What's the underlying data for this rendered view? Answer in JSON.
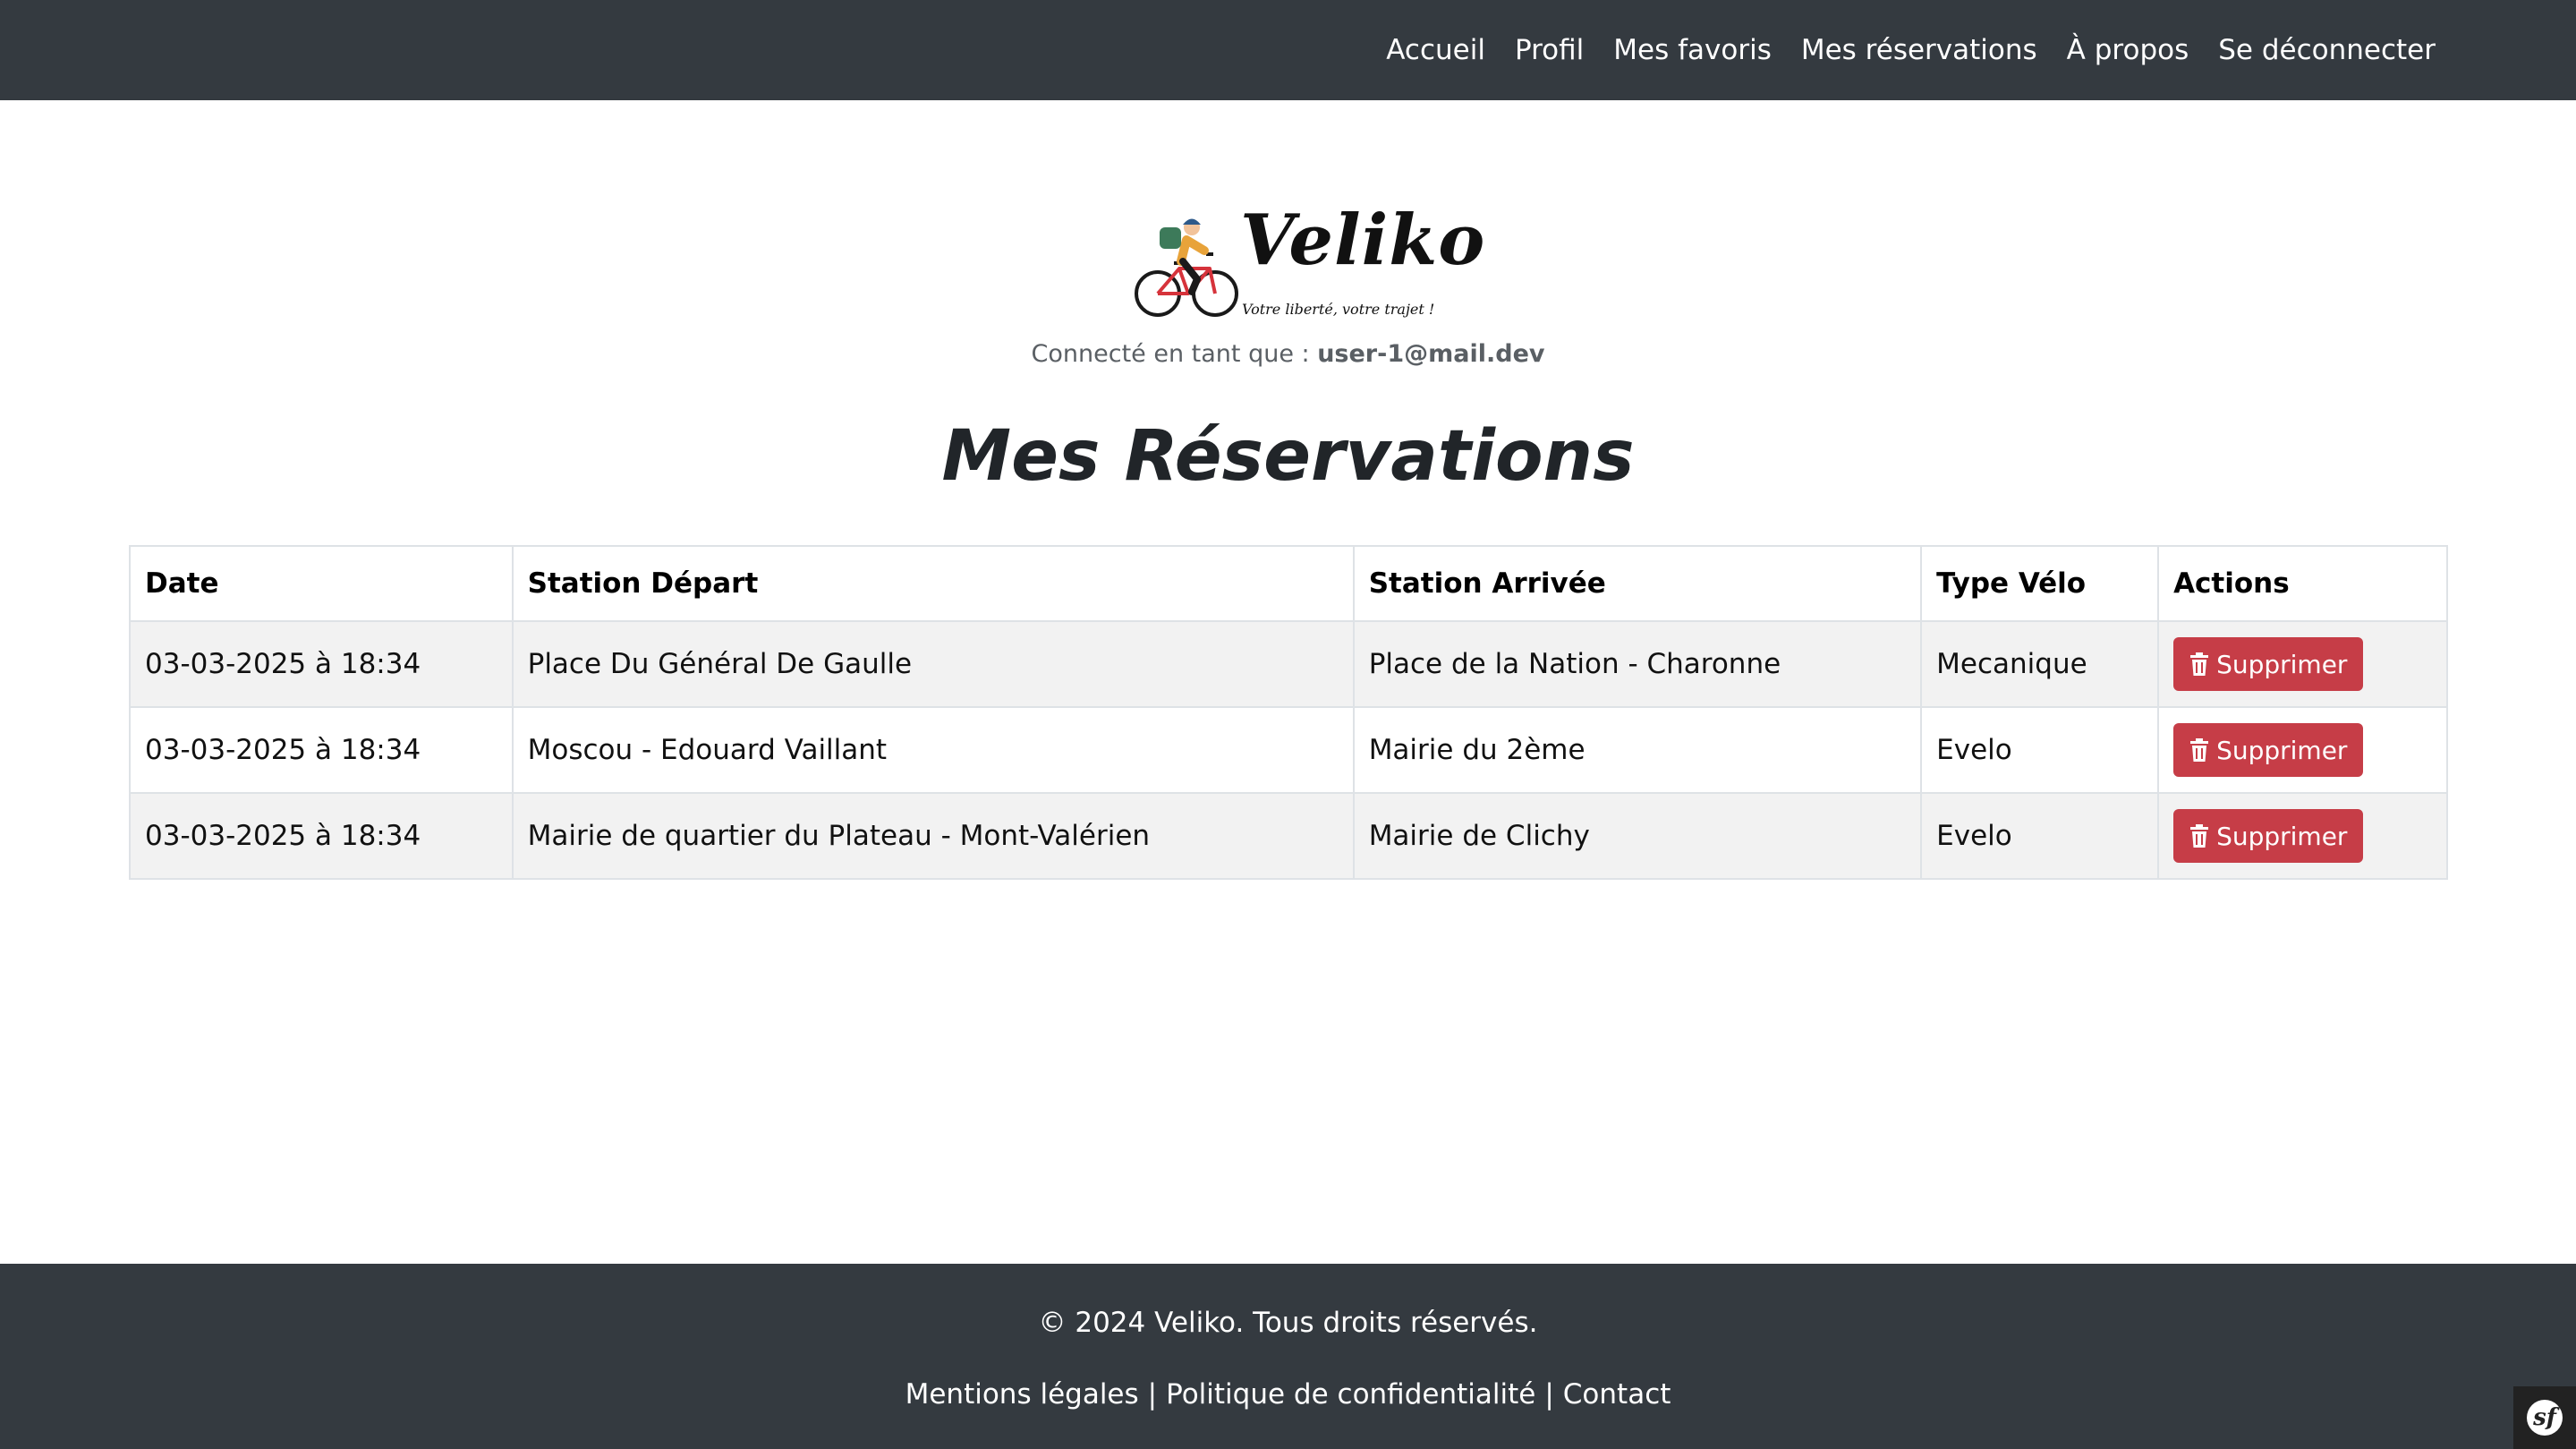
{
  "nav": {
    "items": [
      {
        "label": "Accueil"
      },
      {
        "label": "Profil"
      },
      {
        "label": "Mes favoris"
      },
      {
        "label": "Mes réservations"
      },
      {
        "label": "À propos"
      },
      {
        "label": "Se déconnecter"
      }
    ]
  },
  "brand": {
    "name": "Veliko",
    "tagline": "Votre liberté, votre trajet !"
  },
  "user": {
    "prefix": "Connecté en tant que :",
    "email": "user-1@mail.dev"
  },
  "page": {
    "title": "Mes Réservations"
  },
  "table": {
    "headers": [
      "Date",
      "Station Départ",
      "Station Arrivée",
      "Type Vélo",
      "Actions"
    ],
    "rows": [
      {
        "date": "03-03-2025 à 18:34",
        "depart": "Place Du Général De Gaulle",
        "arrivee": "Place de la Nation - Charonne",
        "type": "Mecanique",
        "action": "Supprimer"
      },
      {
        "date": "03-03-2025 à 18:34",
        "depart": "Moscou - Edouard Vaillant",
        "arrivee": "Mairie du 2ème",
        "type": "Evelo",
        "action": "Supprimer"
      },
      {
        "date": "03-03-2025 à 18:34",
        "depart": "Mairie de quartier du Plateau - Mont-Valérien",
        "arrivee": "Mairie de Clichy",
        "type": "Evelo",
        "action": "Supprimer"
      }
    ]
  },
  "footer": {
    "copyright": "© 2024 Veliko. Tous droits réservés.",
    "links": [
      "Mentions légales",
      "Politique de confidentialité",
      "Contact"
    ],
    "separator": "|"
  },
  "colors": {
    "navbar": "#343a40",
    "danger": "#c63d47",
    "striped_row": "#f2f2f2"
  },
  "icons": {
    "delete": "trash-icon",
    "debug": "symfony-toolbar-icon"
  }
}
